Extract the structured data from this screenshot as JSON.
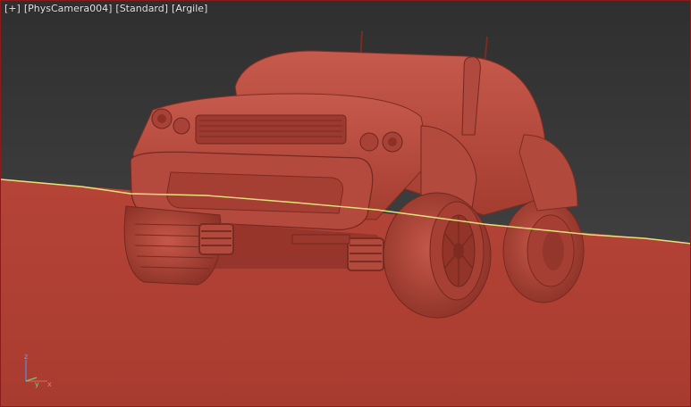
{
  "viewport": {
    "plus_menu": "[+]",
    "camera_menu": "[PhysCamera004]",
    "shading_menu": "[Standard]",
    "display_menu": "[Argile]"
  },
  "gizmo": {
    "z_label": "z",
    "y_label": "y",
    "x_label": "x"
  },
  "colors": {
    "clay": "#b9483c",
    "clay_dark": "#8f3329",
    "clay_shadow": "#6e251f",
    "horizon_line": "#e6e37a",
    "viewport_border": "#8b1a1a",
    "background_top": "#2f2f2f"
  },
  "icons": {
    "axis": "axis-tripod-icon"
  }
}
